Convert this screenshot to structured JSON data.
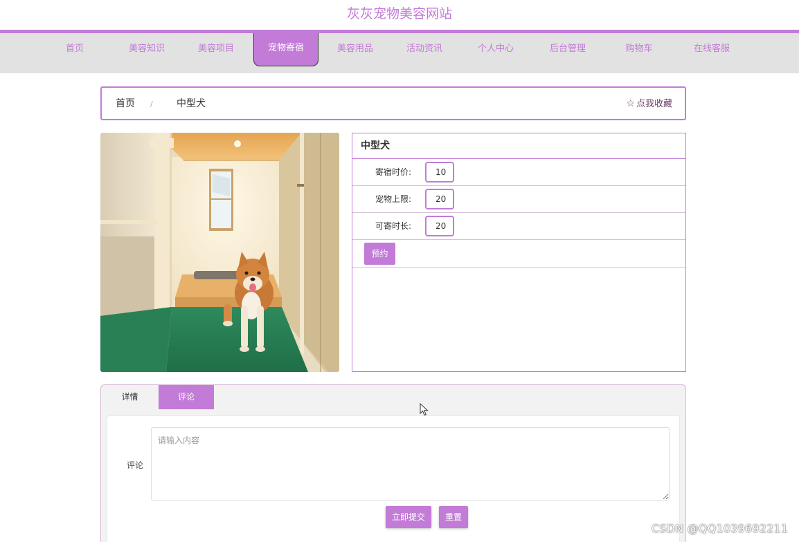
{
  "site": {
    "title": "灰灰宠物美容网站"
  },
  "nav": {
    "items": [
      {
        "label": "首页"
      },
      {
        "label": "美容知识"
      },
      {
        "label": "美容项目"
      },
      {
        "label": "宠物寄宿"
      },
      {
        "label": "美容用品"
      },
      {
        "label": "活动资讯"
      },
      {
        "label": "个人中心"
      },
      {
        "label": "后台管理"
      },
      {
        "label": "购物车"
      },
      {
        "label": "在线客服"
      }
    ],
    "active": "宠物寄宿"
  },
  "breadcrumb": {
    "home": "首页",
    "separator": "/",
    "current": "中型犬",
    "favorite": "点我收藏",
    "favorite_icon": "star-outline-icon"
  },
  "product": {
    "name": "中型犬",
    "fields": [
      {
        "label": "寄宿时价:",
        "value": "10"
      },
      {
        "label": "宠物上限:",
        "value": "20"
      },
      {
        "label": "可寄时长:",
        "value": "20"
      }
    ],
    "book_label": "预约"
  },
  "tabs": {
    "detail": "详情",
    "comment": "评论",
    "active": "评论"
  },
  "comment_form": {
    "label": "评论",
    "placeholder": "请输入内容",
    "submit_label": "立即提交",
    "reset_label": "重置"
  },
  "watermark": "CSDN @QQ1039692211",
  "colors": {
    "accent": "#c27bd6",
    "nav_bg": "#e2e2e2",
    "panel_bg": "#f2f2f2"
  }
}
